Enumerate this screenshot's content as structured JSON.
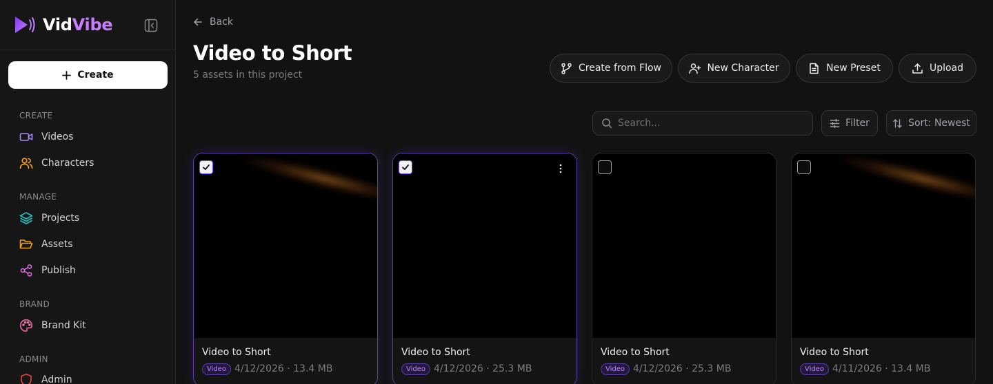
{
  "app": {
    "brand_part1": "Vid",
    "brand_part2": "Vibe",
    "accent_color": "#c77dff",
    "create_label": "Create"
  },
  "sidebar": {
    "sections": [
      {
        "label": "CREATE",
        "items": [
          {
            "label": "Videos",
            "icon": "video-icon",
            "color": "#a78bfa"
          },
          {
            "label": "Characters",
            "icon": "users-icon",
            "color": "#f5a524"
          }
        ]
      },
      {
        "label": "MANAGE",
        "items": [
          {
            "label": "Projects",
            "icon": "layers-icon",
            "color": "#22c1c3"
          },
          {
            "label": "Assets",
            "icon": "folder-open-icon",
            "color": "#f59e0b"
          },
          {
            "label": "Publish",
            "icon": "share-icon",
            "color": "#d86bd9"
          }
        ]
      },
      {
        "label": "BRAND",
        "items": [
          {
            "label": "Brand Kit",
            "icon": "palette-icon",
            "color": "#ec6aa7"
          }
        ]
      },
      {
        "label": "ADMIN",
        "items": [
          {
            "label": "Admin",
            "icon": "shield-icon",
            "color": "#ef4444"
          }
        ]
      }
    ]
  },
  "header": {
    "back_label": "Back",
    "title": "Video to Short",
    "subtitle": "5 assets in this project",
    "actions": {
      "create_from_flow": "Create from Flow",
      "new_character": "New Character",
      "new_preset": "New Preset",
      "upload": "Upload"
    }
  },
  "toolbar": {
    "search_placeholder": "Search...",
    "filter_label": "Filter",
    "sort_label": "Sort: Newest"
  },
  "assets": [
    {
      "title": "Video to Short",
      "badge": "Video",
      "meta": "4/12/2026 · 13.4 MB",
      "selected": true
    },
    {
      "title": "Video to Short",
      "badge": "Video",
      "meta": "4/12/2026 · 25.3 MB",
      "selected": true
    },
    {
      "title": "Video to Short",
      "badge": "Video",
      "meta": "4/12/2026 · 25.3 MB",
      "selected": false
    },
    {
      "title": "Video to Short",
      "badge": "Video",
      "meta": "4/11/2026 · 13.4 MB",
      "selected": false
    }
  ]
}
